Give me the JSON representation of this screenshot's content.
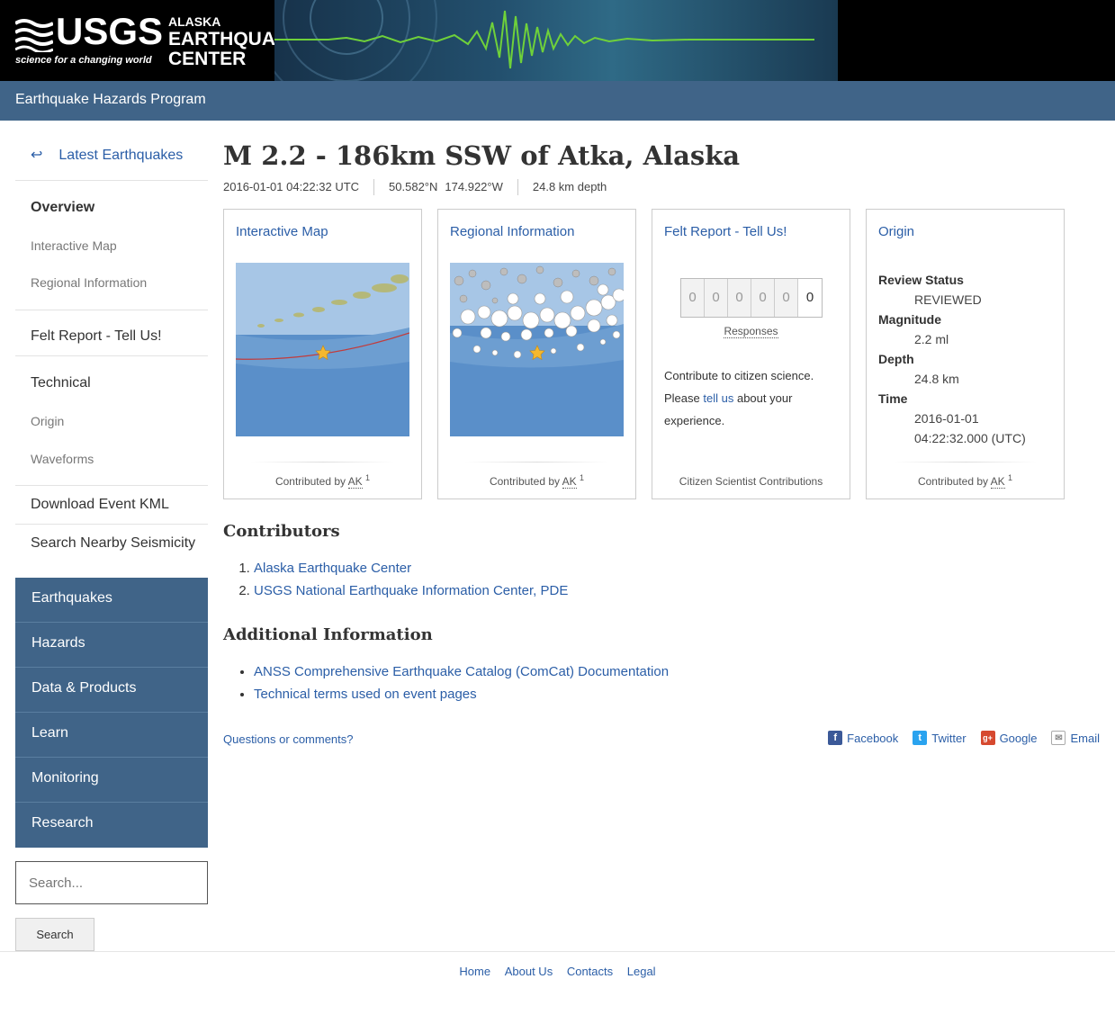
{
  "header": {
    "logo_text": "USGS",
    "tagline": "science for a changing world",
    "center_line1": "ALASKA",
    "center_line2": "EARTHQUAKE",
    "center_line3": "CENTER"
  },
  "navbar": {
    "program": "Earthquake Hazards Program"
  },
  "sidebar": {
    "latest": "Latest Earthquakes",
    "overview": "Overview",
    "interactive_map": "Interactive Map",
    "regional_information": "Regional Information",
    "felt_report": "Felt Report - Tell Us!",
    "technical": "Technical",
    "origin": "Origin",
    "waveforms": "Waveforms",
    "download_kml": "Download Event KML",
    "search_nearby": "Search Nearby Seismicity"
  },
  "site_nav": [
    "Earthquakes",
    "Hazards",
    "Data & Products",
    "Learn",
    "Monitoring",
    "Research"
  ],
  "search": {
    "placeholder": "Search...",
    "button": "Search"
  },
  "event": {
    "title": "M 2.2 - 186km SSW of Atka, Alaska",
    "time": "2016-01-01 04:22:32 UTC",
    "lat": "50.582°N",
    "lon": "174.922°W",
    "depth": "24.8 km depth"
  },
  "cards": {
    "map": {
      "title": "Interactive Map",
      "contrib": "Contributed by",
      "source": "AK",
      "sup": "1"
    },
    "regional": {
      "title": "Regional Information",
      "contrib": "Contributed by",
      "source": "AK",
      "sup": "1"
    },
    "felt": {
      "title": "Felt Report - Tell Us!",
      "digits": [
        "0",
        "0",
        "0",
        "0",
        "0",
        "0"
      ],
      "responses": "Responses",
      "text1": "Contribute to citizen science.",
      "text2a": "Please",
      "tell_us": "tell us",
      "text2b": "about your",
      "text3": "experience.",
      "foot": "Citizen Scientist Contributions"
    },
    "origin": {
      "title": "Origin",
      "review_label": "Review Status",
      "review_value": "REVIEWED",
      "mag_label": "Magnitude",
      "mag_value": "2.2 ml",
      "depth_label": "Depth",
      "depth_value": "24.8 km",
      "time_label": "Time",
      "time_date": "2016-01-01",
      "time_clock": "04:22:32.000 (UTC)",
      "contrib": "Contributed by",
      "source": "AK",
      "sup": "1"
    }
  },
  "contributors": {
    "heading": "Contributors",
    "items": [
      "Alaska Earthquake Center",
      "USGS National Earthquake Information Center, PDE"
    ]
  },
  "additional": {
    "heading": "Additional Information",
    "items": [
      "ANSS Comprehensive Earthquake Catalog (ComCat) Documentation",
      "Technical terms used on event pages"
    ]
  },
  "questions": "Questions or comments?",
  "share": {
    "facebook": "Facebook",
    "twitter": "Twitter",
    "google": "Google",
    "email": "Email"
  },
  "footer": [
    "Home",
    "About Us",
    "Contacts",
    "Legal"
  ],
  "colors": {
    "nav_blue": "#406488",
    "link": "#2b5ea7"
  }
}
